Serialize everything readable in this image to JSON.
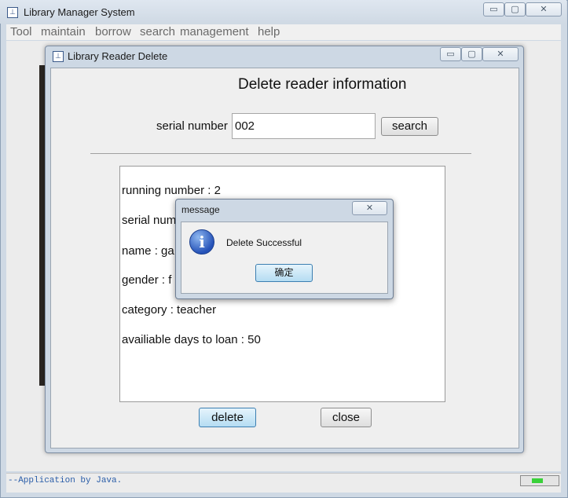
{
  "app": {
    "title": "Library Manager System",
    "icon": "java-app-icon",
    "controls": {
      "minimize": "▭",
      "maximize": "▢",
      "close": "✕"
    }
  },
  "menu": {
    "items": [
      "Tool",
      "maintain",
      "borrow",
      "search",
      "management",
      "help"
    ]
  },
  "status_bar": {
    "text": "--Application by Java."
  },
  "reader_delete_window": {
    "title": "Library Reader Delete",
    "heading": "Delete reader information",
    "serial_label": "serial number",
    "serial_value": "002",
    "search_button": "search",
    "info_lines": [
      "running number : 2",
      "serial num",
      "name : ga",
      "gender : f",
      "category : teacher",
      "availiable days to loan : 50"
    ],
    "delete_button": "delete",
    "close_button": "close"
  },
  "message_dialog": {
    "title": "message",
    "icon": "information-icon",
    "text": "Delete Successful",
    "ok_button": "确定"
  },
  "colors": {
    "titlebar": "#cfd9e4",
    "status_text": "#2a5da8",
    "progress_fill": "#3ad13a",
    "info_icon": "#2552b8"
  }
}
